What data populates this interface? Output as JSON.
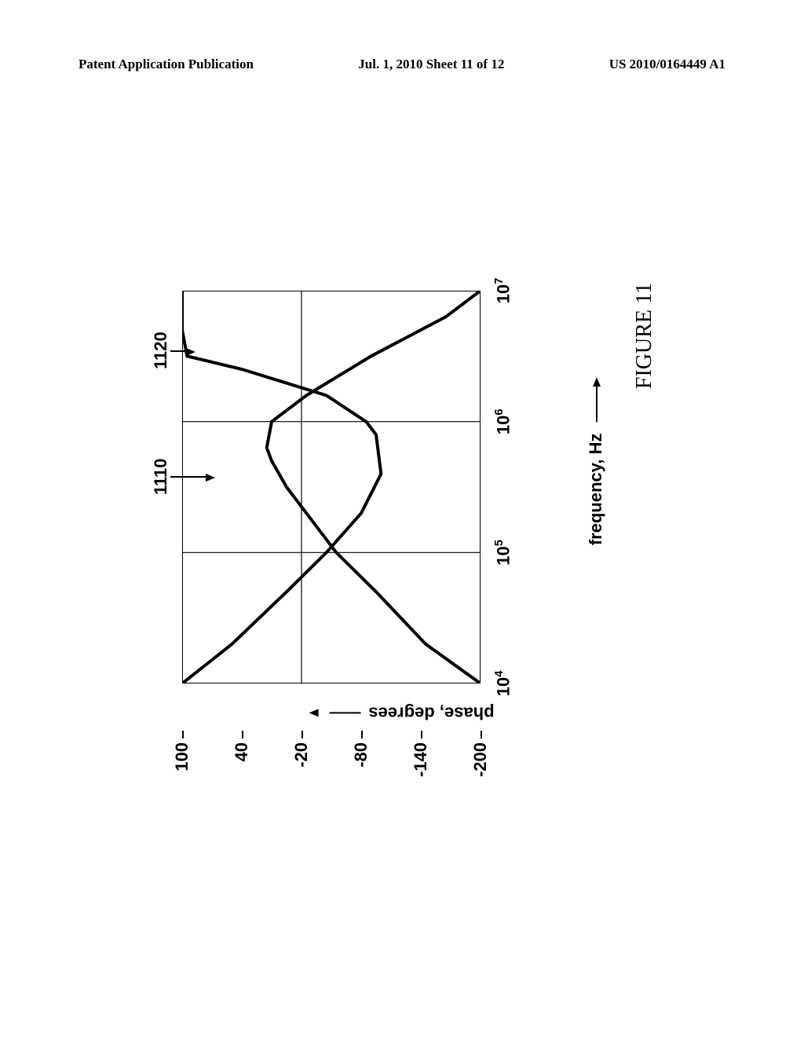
{
  "header": {
    "left": "Patent Application Publication",
    "center": "Jul. 1, 2010  Sheet 11 of 12",
    "right": "US 2010/0164449 A1"
  },
  "chart_data": {
    "type": "line",
    "title": "",
    "xlabel": "frequency, Hz",
    "ylabel": "phase, degrees",
    "ylim": [
      -200,
      100
    ],
    "xlim_log": [
      4,
      7
    ],
    "y_ticks": [
      100,
      40,
      -20,
      -80,
      -140,
      -200
    ],
    "x_ticks_exp": [
      4,
      5,
      6,
      7
    ],
    "series": [
      {
        "name": "1110",
        "x_log": [
          4.0,
          4.3,
          4.7,
          5.0,
          5.3,
          5.5,
          5.7,
          5.8,
          6.0,
          6.2,
          6.5,
          6.8,
          7.0
        ],
        "values": [
          -200,
          -145,
          -95,
          -55,
          -25,
          -5,
          10,
          15,
          10,
          -25,
          -90,
          -165,
          -200
        ]
      },
      {
        "name": "1120",
        "x_log": [
          4.0,
          4.3,
          4.7,
          5.0,
          5.3,
          5.6,
          5.9,
          6.0,
          6.2,
          6.4,
          6.5,
          6.7,
          7.0
        ],
        "values": [
          100,
          50,
          -5,
          -45,
          -80,
          -100,
          -95,
          -85,
          -45,
          40,
          95,
          100,
          100
        ]
      }
    ],
    "reference_labels": [
      "1110",
      "1120"
    ]
  },
  "figure_label": "FIGURE 11"
}
